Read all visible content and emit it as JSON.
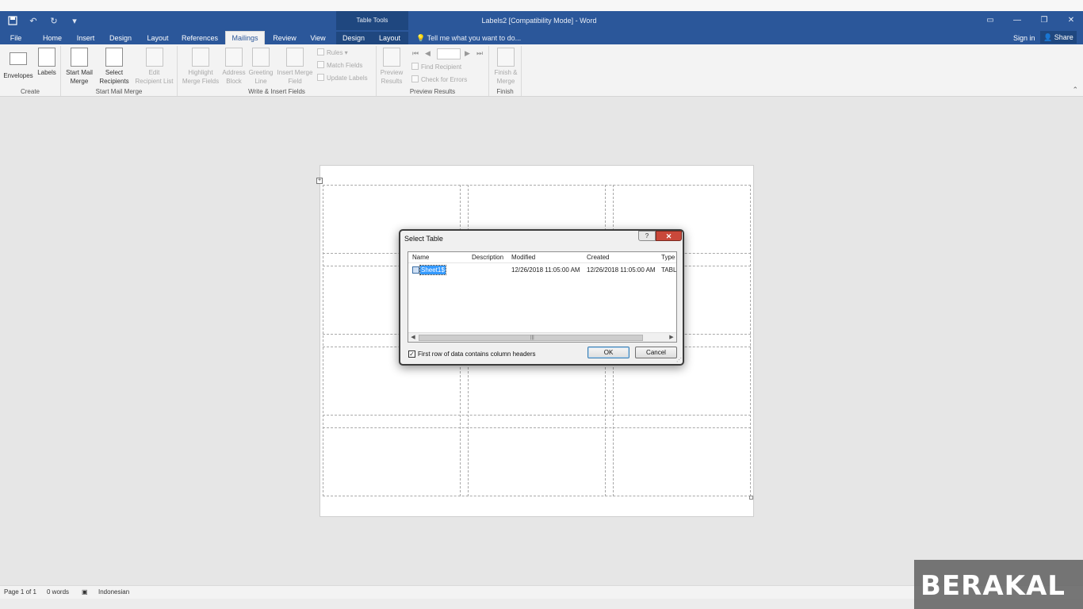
{
  "title_bar": {
    "doc_title": "Labels2 [Compatibility Mode] - Word",
    "context_label": "Table Tools"
  },
  "tabs": [
    "File",
    "Home",
    "Insert",
    "Design",
    "Layout",
    "References",
    "Mailings",
    "Review",
    "View",
    "Design",
    "Layout"
  ],
  "active_tab": "Mailings",
  "tell_me": "Tell me what you want to do...",
  "sign_in": "Sign in",
  "share": "Share",
  "ribbon": {
    "create": {
      "label": "Create",
      "envelopes": "Envelopes",
      "labels": "Labels"
    },
    "start_mail_merge": {
      "label": "Start Mail Merge",
      "start": [
        "Start Mail",
        "Merge"
      ],
      "select": [
        "Select",
        "Recipients"
      ],
      "edit": [
        "Edit",
        "Recipient List"
      ]
    },
    "write_insert": {
      "label": "Write & Insert Fields",
      "highlight": [
        "Highlight",
        "Merge Fields"
      ],
      "address": [
        "Address",
        "Block"
      ],
      "greeting": [
        "Greeting",
        "Line"
      ],
      "insert_merge": [
        "Insert Merge",
        "Field"
      ],
      "rules": "Rules",
      "match": "Match Fields",
      "update": "Update Labels"
    },
    "preview": {
      "label": "Preview Results",
      "preview": [
        "Preview",
        "Results"
      ],
      "find": "Find Recipient",
      "check": "Check for Errors"
    },
    "finish": {
      "label": "Finish",
      "finish": [
        "Finish &",
        "Merge"
      ]
    }
  },
  "dialog": {
    "title": "Select Table",
    "help": "?",
    "close": "✕",
    "columns": [
      "Name",
      "Description",
      "Modified",
      "Created",
      "Type"
    ],
    "rows": [
      {
        "name": "Sheet1$",
        "description": "",
        "modified": "12/26/2018 11:05:00 AM",
        "created": "12/26/2018 11:05:00 AM",
        "type": "TABLE"
      }
    ],
    "checkbox_label": "First row of data contains column headers",
    "checkbox_checked": true,
    "ok": "OK",
    "cancel": "Cancel"
  },
  "status_bar": {
    "page": "Page 1 of 1",
    "words": "0 words",
    "language": "Indonesian"
  },
  "watermark": "BERAKAL"
}
